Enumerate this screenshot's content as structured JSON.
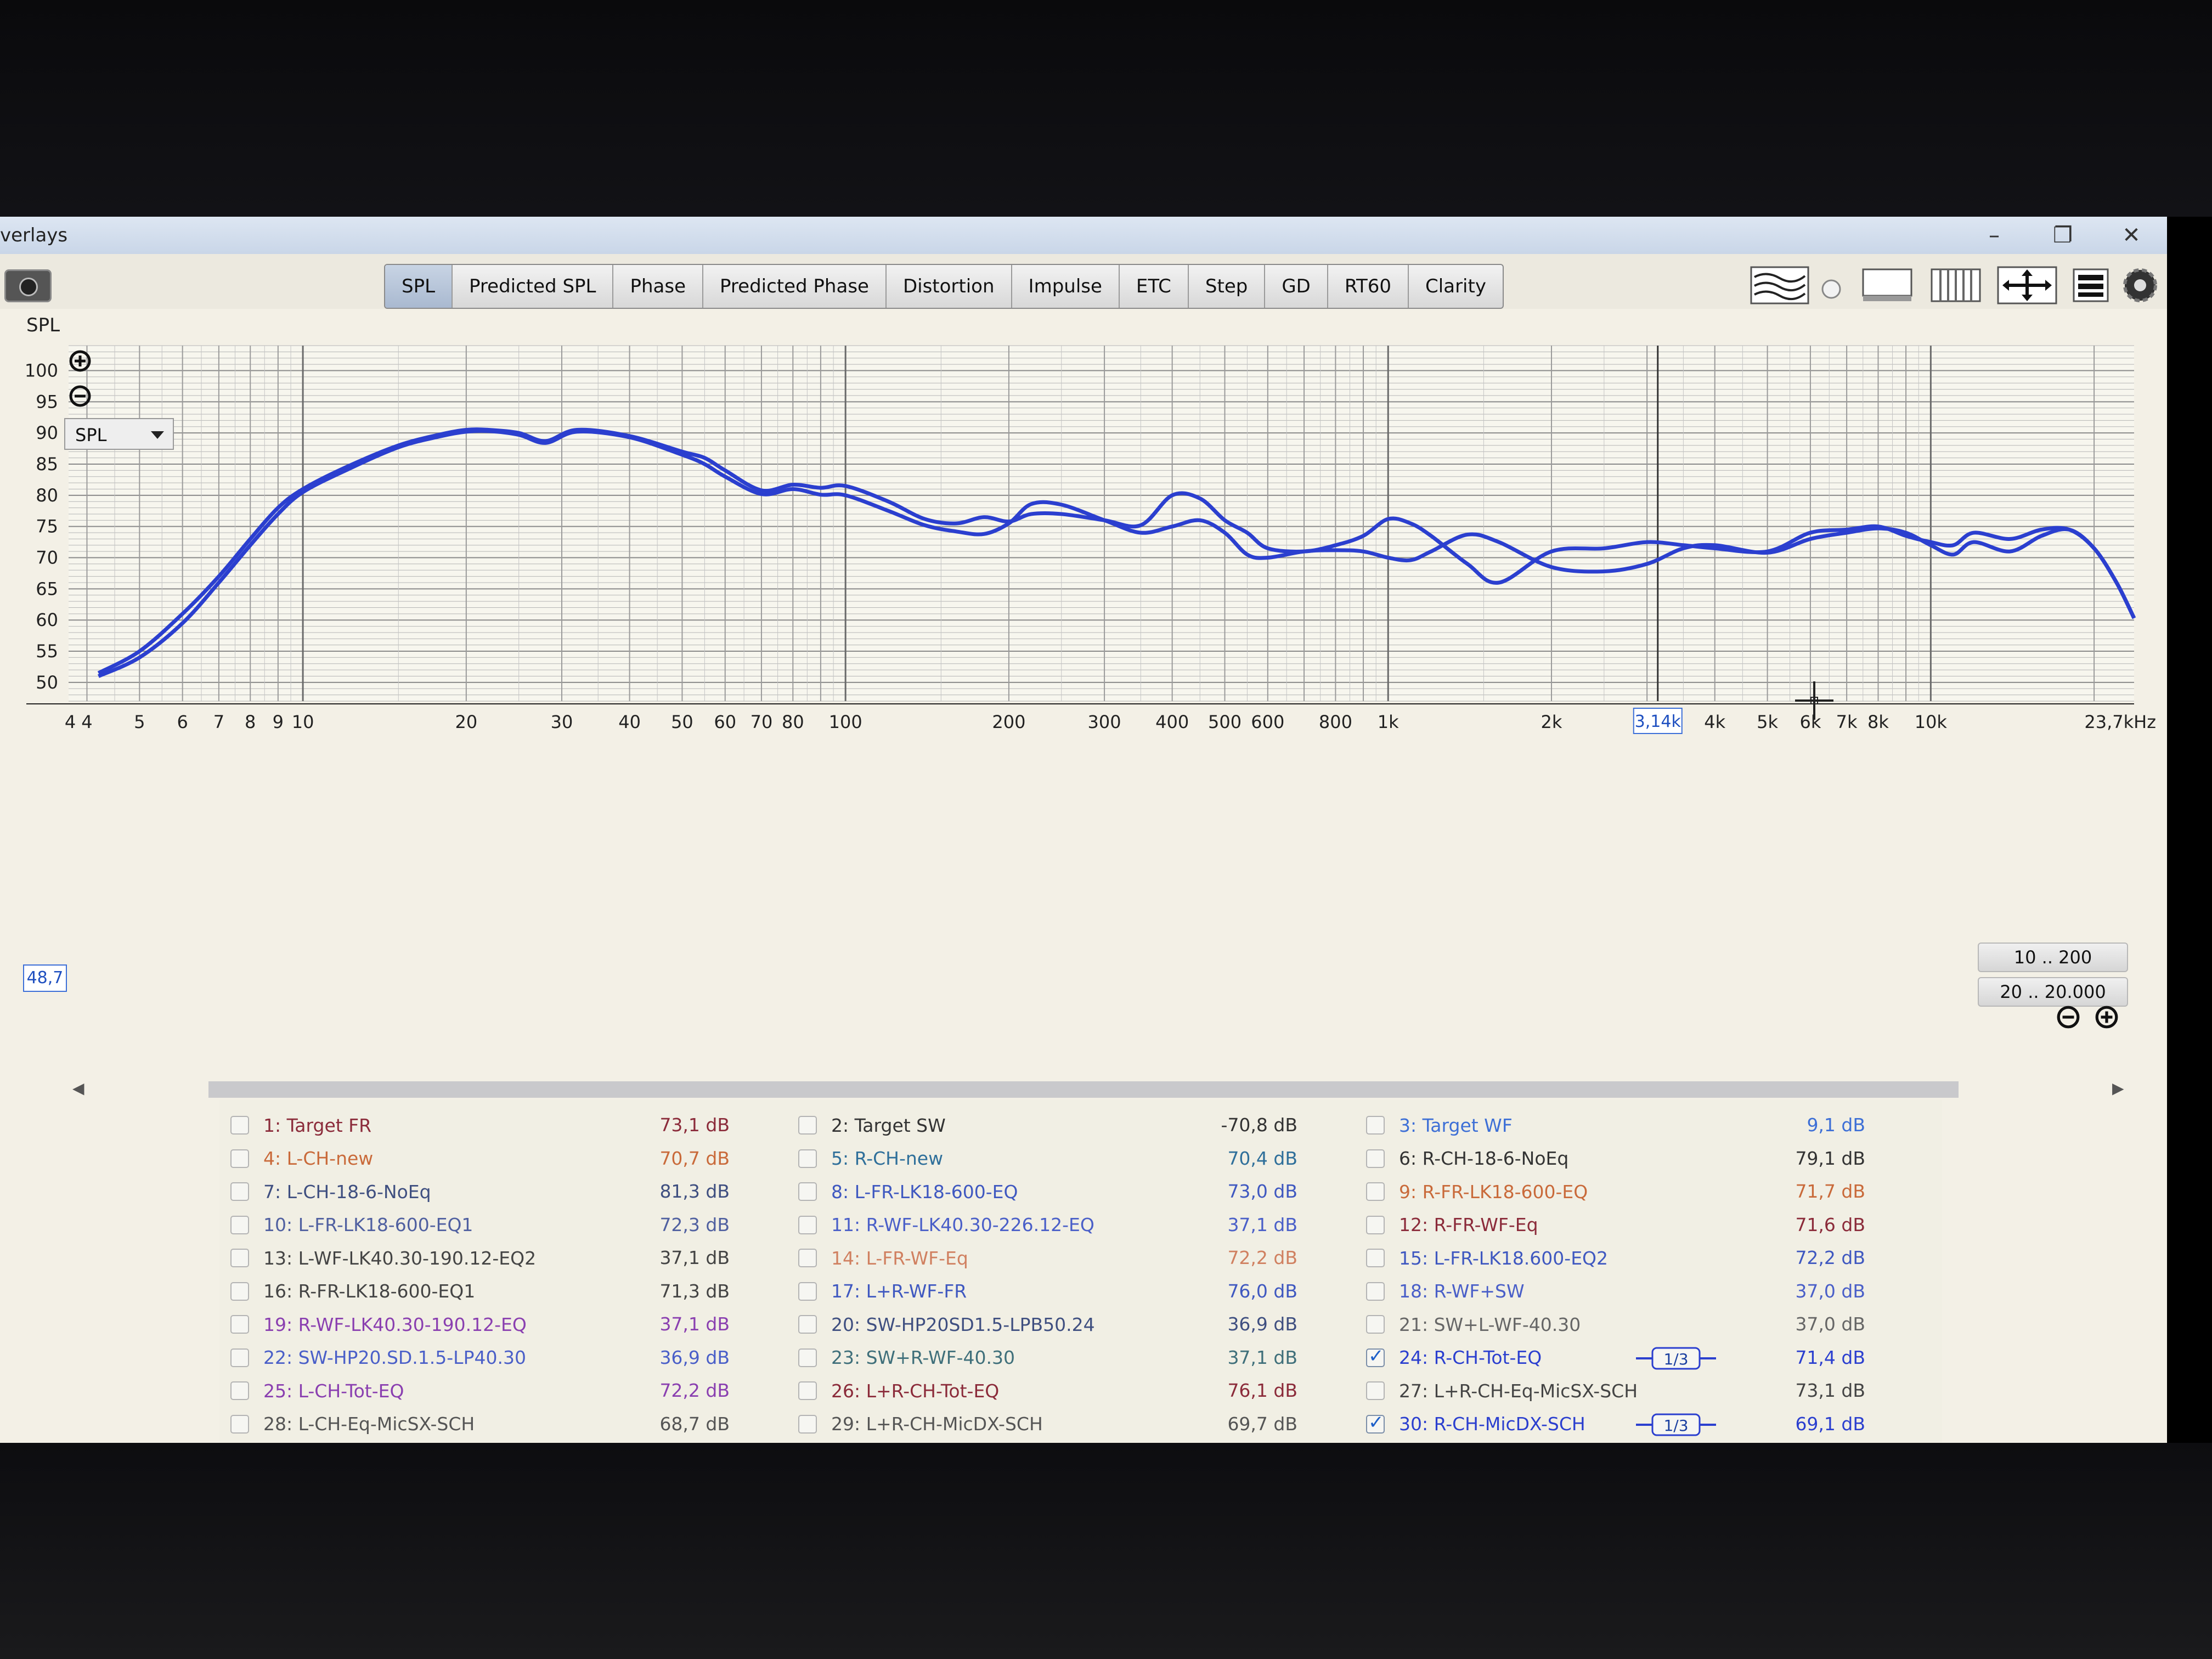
{
  "window": {
    "title": "verlays"
  },
  "toolbar": {
    "tabs": [
      {
        "label": "SPL",
        "active": true
      },
      {
        "label": "Predicted SPL"
      },
      {
        "label": "Phase"
      },
      {
        "label": "Predicted Phase"
      },
      {
        "label": "Distortion"
      },
      {
        "label": "Impulse"
      },
      {
        "label": "ETC"
      },
      {
        "label": "Step"
      },
      {
        "label": "GD"
      },
      {
        "label": "RT60"
      },
      {
        "label": "Clarity"
      }
    ],
    "icons": [
      "camera-icon",
      "waterfall-icon",
      "radio-dot-icon",
      "window-layout-icon",
      "columns-icon",
      "move-arrows-icon",
      "stack-icon",
      "gear-icon"
    ]
  },
  "graph": {
    "measure_label": "SPL",
    "dropdown_value": "SPL",
    "cursor_readout": "48,7",
    "range_buttons": [
      "10 .. 200",
      "20 .. 20.000"
    ],
    "freq_marker": "3,14k",
    "colors": {
      "curve": "#2b3fcf",
      "grid": "#9a9a9a",
      "background": "#f7f6ee"
    }
  },
  "chart_data": {
    "type": "line",
    "xscale": "log",
    "xlim": [
      3.7,
      23700
    ],
    "ylim": [
      47,
      104
    ],
    "y_ticks": [
      "100",
      "95",
      "90",
      "85",
      "80",
      "75",
      "70",
      "65",
      "60",
      "55",
      "50"
    ],
    "x_tick_labels": [
      {
        "f": 3.7,
        "label": "4"
      },
      {
        "f": 4,
        "label": "4"
      },
      {
        "f": 5,
        "label": "5"
      },
      {
        "f": 6,
        "label": "6"
      },
      {
        "f": 7,
        "label": "7"
      },
      {
        "f": 8,
        "label": "8"
      },
      {
        "f": 9,
        "label": "9"
      },
      {
        "f": 10,
        "label": "10"
      },
      {
        "f": 20,
        "label": "20"
      },
      {
        "f": 30,
        "label": "30"
      },
      {
        "f": 40,
        "label": "40"
      },
      {
        "f": 50,
        "label": "50"
      },
      {
        "f": 60,
        "label": "60"
      },
      {
        "f": 70,
        "label": "70"
      },
      {
        "f": 80,
        "label": "80"
      },
      {
        "f": 100,
        "label": "100"
      },
      {
        "f": 200,
        "label": "200"
      },
      {
        "f": 300,
        "label": "300"
      },
      {
        "f": 400,
        "label": "400"
      },
      {
        "f": 500,
        "label": "500"
      },
      {
        "f": 600,
        "label": "600"
      },
      {
        "f": 800,
        "label": "800"
      },
      {
        "f": 1000,
        "label": "1k"
      },
      {
        "f": 2000,
        "label": "2k"
      },
      {
        "f": 4000,
        "label": "4k"
      },
      {
        "f": 5000,
        "label": "5k"
      },
      {
        "f": 6000,
        "label": "6k"
      },
      {
        "f": 7000,
        "label": "7k"
      },
      {
        "f": 8000,
        "label": "8k"
      },
      {
        "f": 10000,
        "label": "10k"
      },
      {
        "f": 23700,
        "label": "23,7kHz"
      }
    ],
    "series": [
      {
        "name": "24: R-CH-Tot-EQ",
        "color": "#2b3fcf",
        "x": [
          4.2,
          5,
          6,
          7,
          8,
          9,
          10,
          12,
          15,
          18,
          20,
          22,
          25,
          28,
          32,
          40,
          50,
          55,
          60,
          70,
          80,
          90,
          100,
          120,
          140,
          160,
          180,
          200,
          220,
          250,
          300,
          350,
          400,
          450,
          500,
          550,
          600,
          700,
          800,
          900,
          1000,
          1100,
          1200,
          1400,
          1600,
          2000,
          2500,
          3000,
          3500,
          4000,
          5000,
          6000,
          7000,
          8000,
          9000,
          10000,
          11000,
          12000,
          14000,
          16000,
          18000,
          20000,
          22000,
          23700
        ],
        "y": [
          51.5,
          55,
          61,
          67,
          73,
          78,
          81,
          84.5,
          88,
          89.8,
          90.5,
          90.5,
          90,
          88.7,
          90.5,
          89.5,
          87,
          86,
          84,
          80.8,
          81.7,
          81.2,
          81.5,
          79,
          76.2,
          75.5,
          76.5,
          75.8,
          77,
          77,
          76,
          75.2,
          80,
          79.5,
          76,
          74,
          71.5,
          71,
          72,
          73.5,
          76.2,
          75.5,
          73.5,
          69,
          66,
          71,
          71.5,
          72.5,
          72,
          71.5,
          71,
          74,
          74.5,
          75,
          73.5,
          72.5,
          72,
          74,
          73,
          74.5,
          74.5,
          71.5,
          66,
          60.3
        ]
      },
      {
        "name": "30: R-CH-MicDX-SCH",
        "color": "#2b3fcf",
        "x": [
          4.2,
          5,
          6,
          7,
          8,
          9,
          10,
          12,
          15,
          18,
          20,
          22,
          25,
          28,
          32,
          40,
          50,
          55,
          60,
          70,
          80,
          90,
          100,
          120,
          140,
          160,
          180,
          200,
          220,
          250,
          300,
          350,
          400,
          450,
          500,
          550,
          600,
          700,
          800,
          900,
          1000,
          1100,
          1200,
          1400,
          1600,
          2000,
          2500,
          3000,
          3500,
          4000,
          5000,
          6000,
          7000,
          8000,
          9000,
          10000,
          11000,
          12000,
          14000,
          16000,
          18000,
          20000,
          22000,
          23700
        ],
        "y": [
          51,
          54,
          59.5,
          66,
          72,
          77,
          80.5,
          84,
          87.7,
          89.5,
          90.2,
          90.3,
          89.7,
          88.4,
          90.2,
          89.3,
          86.5,
          85,
          83,
          80.2,
          81,
          80.1,
          80,
          77.5,
          75.2,
          74.2,
          73.8,
          75.5,
          78.6,
          78.5,
          76,
          74,
          75,
          76,
          74,
          70.5,
          70,
          71,
          71.2,
          71,
          70,
          69.6,
          71,
          73.7,
          72.5,
          68.5,
          67.8,
          69,
          71.5,
          72,
          70.8,
          73,
          74,
          74.7,
          74,
          72,
          70.5,
          72.5,
          71,
          73.5,
          74.5,
          71.5,
          66,
          60.3
        ]
      }
    ]
  },
  "scrollbar": {
    "left_arrow": "◀",
    "right_arrow": "▶"
  },
  "legend": {
    "items": [
      {
        "label": "1: Target FR",
        "value": "73,1 dB",
        "color": "#8b2b3a",
        "checked": false
      },
      {
        "label": "2: Target SW",
        "value": "-70,8 dB",
        "color": "#333333",
        "checked": false
      },
      {
        "label": "3: Target WF",
        "value": "9,1 dB",
        "color": "#3d6fd6",
        "checked": false
      },
      {
        "label": "4: L-CH-new",
        "value": "70,7 dB",
        "color": "#c96a3a",
        "checked": false
      },
      {
        "label": "5: R-CH-new",
        "value": "70,4 dB",
        "color": "#2f6f9a",
        "checked": false
      },
      {
        "label": "6: R-CH-18-6-NoEq",
        "value": "79,1 dB",
        "color": "#333333",
        "checked": false
      },
      {
        "label": "7: L-CH-18-6-NoEq",
        "value": "81,3 dB",
        "color": "#3f4f80",
        "checked": false
      },
      {
        "label": "8: L-FR-LK18-600-EQ",
        "value": "73,0 dB",
        "color": "#3f58c0",
        "checked": false
      },
      {
        "label": "9: R-FR-LK18-600-EQ",
        "value": "71,7 dB",
        "color": "#c96a3a",
        "checked": false
      },
      {
        "label": "10: L-FR-LK18-600-EQ1",
        "value": "72,3 dB",
        "color": "#5060a0",
        "checked": false
      },
      {
        "label": "11: R-WF-LK40.30-226.12-EQ",
        "value": "37,1 dB",
        "color": "#4a5fc8",
        "checked": false
      },
      {
        "label": "12: R-FR-WF-Eq",
        "value": "71,6 dB",
        "color": "#8b2b3a",
        "checked": false
      },
      {
        "label": "13: L-WF-LK40.30-190.12-EQ2",
        "value": "37,1 dB",
        "color": "#444444",
        "checked": false
      },
      {
        "label": "14: L-FR-WF-Eq",
        "value": "72,2 dB",
        "color": "#d08060",
        "checked": false
      },
      {
        "label": "15: L-FR-LK18.600-EQ2",
        "value": "72,2 dB",
        "color": "#3f58c0",
        "checked": false
      },
      {
        "label": "16: R-FR-LK18-600-EQ1",
        "value": "71,3 dB",
        "color": "#444444",
        "checked": false
      },
      {
        "label": "17: L+R-WF-FR",
        "value": "76,0 dB",
        "color": "#3f58c0",
        "checked": false
      },
      {
        "label": "18: R-WF+SW",
        "value": "37,0 dB",
        "color": "#4a5fc8",
        "checked": false
      },
      {
        "label": "19: R-WF-LK40.30-190.12-EQ",
        "value": "37,1 dB",
        "color": "#8a3fb0",
        "checked": false
      },
      {
        "label": "20: SW-HP20SD1.5-LPB50.24",
        "value": "36,9 dB",
        "color": "#3f4f80",
        "checked": false
      },
      {
        "label": "21: SW+L-WF-40.30",
        "value": "37,0 dB",
        "color": "#666666",
        "checked": false
      },
      {
        "label": "22: SW-HP20.SD.1.5-LP40.30",
        "value": "36,9 dB",
        "color": "#4a5fc8",
        "checked": false
      },
      {
        "label": "23: SW+R-WF-40.30",
        "value": "37,1 dB",
        "color": "#3f6f7a",
        "checked": false
      },
      {
        "label": "24: R-CH-Tot-EQ",
        "value": "71,4 dB",
        "color": "#2b3fcf",
        "checked": true,
        "smoothing": "1/3"
      },
      {
        "label": "25: L-CH-Tot-EQ",
        "value": "72,2 dB",
        "color": "#8a3fb0",
        "checked": false
      },
      {
        "label": "26: L+R-CH-Tot-EQ",
        "value": "76,1 dB",
        "color": "#8b2b3a",
        "checked": false
      },
      {
        "label": "27: L+R-CH-Eq-MicSX-SCH",
        "value": "73,1 dB",
        "color": "#444444",
        "checked": false
      },
      {
        "label": "28: L-CH-Eq-MicSX-SCH",
        "value": "68,7 dB",
        "color": "#555555",
        "checked": false
      },
      {
        "label": "29: L+R-CH-MicDX-SCH",
        "value": "69,7 dB",
        "color": "#555555",
        "checked": false
      },
      {
        "label": "30: R-CH-MicDX-SCH",
        "value": "69,1 dB",
        "color": "#2b3fcf",
        "checked": true,
        "smoothing": "1/3"
      }
    ]
  }
}
